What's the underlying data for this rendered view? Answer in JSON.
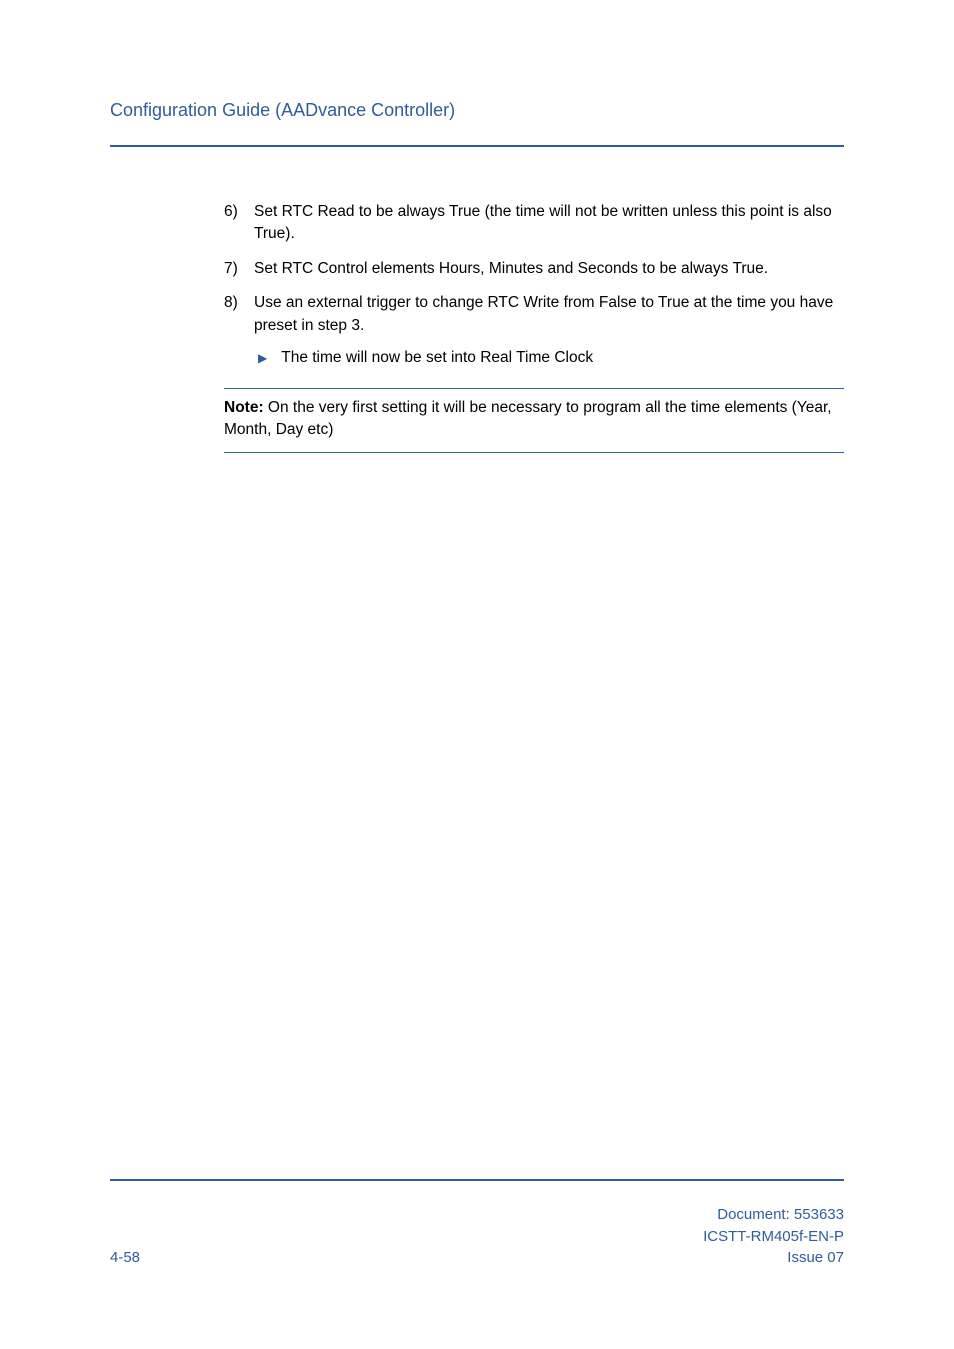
{
  "header": {
    "title": "Configuration Guide (AADvance Controller)"
  },
  "steps": [
    {
      "num": "6)",
      "text": "Set RTC Read to be always True (the time will not be written unless this point is also True)."
    },
    {
      "num": "7)",
      "text": "Set RTC Control elements Hours, Minutes and Seconds to be always True."
    },
    {
      "num": "8)",
      "text": "Use an external trigger to change RTC Write from False to True at the time you have preset in step 3.",
      "sub": "The time will now be set into Real Time Clock"
    }
  ],
  "note": {
    "label": "Note:",
    "text": " On the very first setting it will be necessary to program all the time elements (Year, Month, Day etc)"
  },
  "footer": {
    "page": "4-58",
    "doc_line1": "Document: 553633",
    "doc_line2": "ICSTT-RM405f-EN-P",
    "doc_line3": "Issue 07"
  }
}
